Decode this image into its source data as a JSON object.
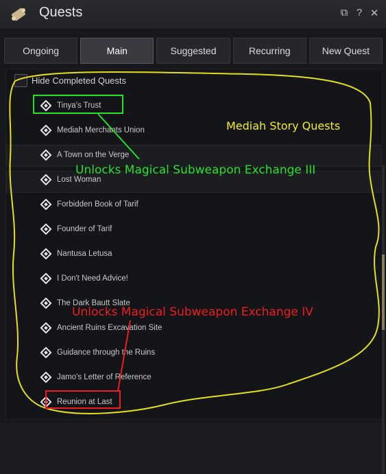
{
  "window": {
    "title": "Quests",
    "controls": [
      "window-detach-icon",
      "help-icon",
      "close-icon"
    ]
  },
  "tabs": [
    {
      "label": "Ongoing"
    },
    {
      "label": "Main",
      "active": true
    },
    {
      "label": "Suggested"
    },
    {
      "label": "Recurring"
    },
    {
      "label": "New Quest"
    }
  ],
  "filter": {
    "hide_completed_label": "Hide Completed Quests",
    "checked": false
  },
  "quests": [
    "Tinya's Trust",
    "Mediah Merchants Union",
    "A Town on the Verge",
    "Lost Woman",
    "Forbidden Book of Tarif",
    "Founder of Tarif",
    "Nantusa Letusa",
    "I Don't Need Advice!",
    "The Dark Bautt Slate",
    "Ancient Ruins Excavation Site",
    "Guidance through the Ruins",
    "Jamo's Letter of Reference",
    "Reunion at Last"
  ],
  "annotations": {
    "group_label": "Mediah Story Quests",
    "unlock_iii": "Unlocks Magical Subweapon Exchange III",
    "unlock_iv": "Unlocks Magical Subweapon Exchange IV",
    "colors": {
      "group": "#f2ee22",
      "unlock_iii": "#22e22a",
      "unlock_iv": "#ee1e1e"
    }
  }
}
